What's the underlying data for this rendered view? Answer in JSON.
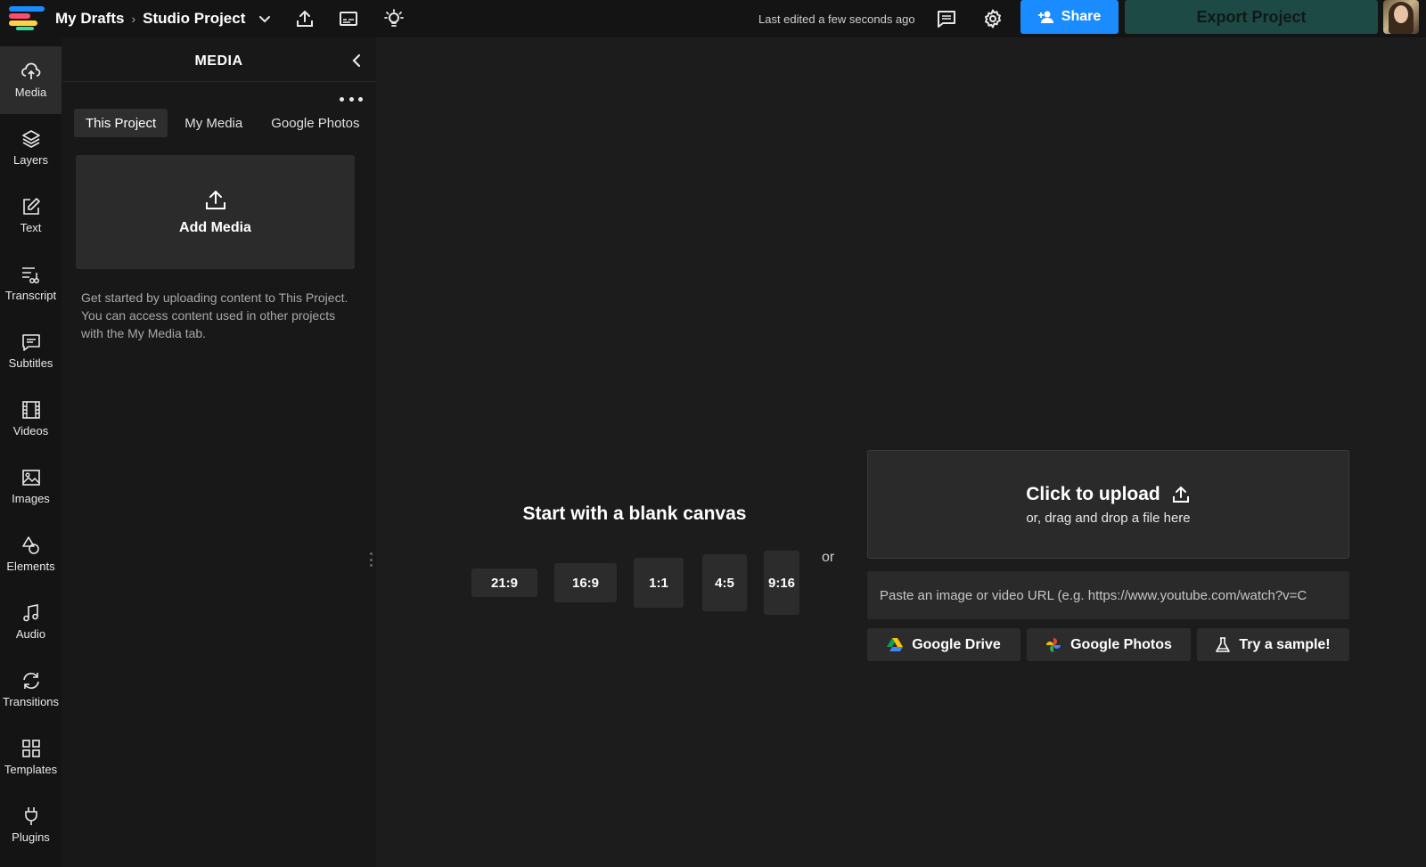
{
  "header": {
    "breadcrumb_root": "My Drafts",
    "breadcrumb_sep": "›",
    "project_name": "Studio Project",
    "last_edited": "Last edited a few seconds ago",
    "share_label": "Share",
    "export_label": "Export Project"
  },
  "sidebar": {
    "items": [
      {
        "label": "Media",
        "icon": "upload-cloud-icon"
      },
      {
        "label": "Layers",
        "icon": "layers-icon"
      },
      {
        "label": "Text",
        "icon": "edit-icon"
      },
      {
        "label": "Transcript",
        "icon": "transcript-icon"
      },
      {
        "label": "Subtitles",
        "icon": "subtitles-icon"
      },
      {
        "label": "Videos",
        "icon": "film-icon"
      },
      {
        "label": "Images",
        "icon": "image-icon"
      },
      {
        "label": "Elements",
        "icon": "shapes-icon"
      },
      {
        "label": "Audio",
        "icon": "music-note-icon"
      },
      {
        "label": "Transitions",
        "icon": "transition-icon"
      },
      {
        "label": "Templates",
        "icon": "grid-icon"
      },
      {
        "label": "Plugins",
        "icon": "plug-icon"
      }
    ],
    "active": "Media"
  },
  "panel": {
    "title": "MEDIA",
    "tabs": [
      "This Project",
      "My Media",
      "Google Photos"
    ],
    "active_tab": "This Project",
    "add_media_label": "Add Media",
    "help_text": "Get started by uploading content to This Project. You can access content used in other projects with the My Media tab."
  },
  "canvas": {
    "blank_title": "Start with a blank canvas",
    "ratios": [
      "21:9",
      "16:9",
      "1:1",
      "4:5",
      "9:16"
    ],
    "or_label": "or",
    "upload_title": "Click to upload",
    "upload_subtitle": "or, drag and drop a file here",
    "url_placeholder": "Paste an image or video URL (e.g. https://www.youtube.com/watch?v=C",
    "sources": [
      "Google Drive",
      "Google Photos",
      "Try a sample!"
    ]
  },
  "colors": {
    "accent": "#1a8cff",
    "export": "#1e4a45",
    "logo": [
      "#1a8cff",
      "#ff4d6d",
      "#ffd23f",
      "#3ddc97"
    ]
  }
}
